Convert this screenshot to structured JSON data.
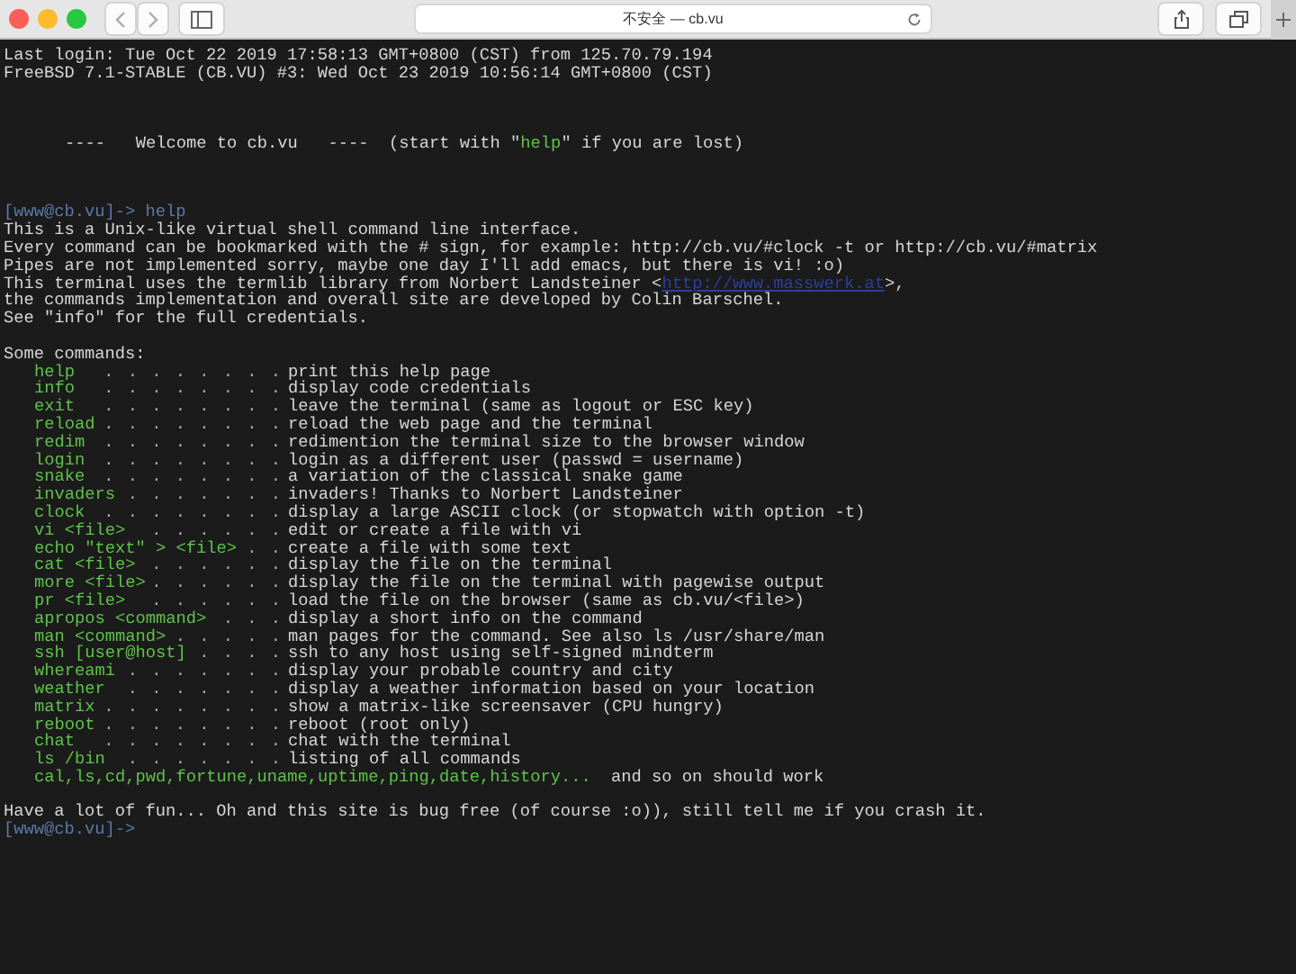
{
  "browser": {
    "address": "不安全 — cb.vu"
  },
  "login_lines": [
    "Last login: Tue Oct 22 2019 17:58:13 GMT+0800 (CST) from 125.70.79.194",
    "FreeBSD 7.1-STABLE (CB.VU) #3: Wed Oct 23 2019 10:56:14 GMT+0800 (CST)"
  ],
  "welcome": [
    {
      "kind": "plain",
      "text": "----   Welcome to cb.vu   ----  (start with \""
    },
    {
      "kind": "command",
      "text": "help"
    },
    {
      "kind": "plain",
      "text": "\" if you are lost)"
    }
  ],
  "help_prompt": {
    "prompt": "[www@cb.vu]->",
    "command": "help"
  },
  "help_lines": [
    [
      {
        "kind": "plain",
        "text": "This is a Unix-like virtual shell command line interface."
      }
    ],
    [
      {
        "kind": "plain",
        "text": "Every command can be bookmarked with the # sign, for example: http://cb.vu/#clock -t or http://cb.vu/#matrix"
      }
    ],
    [
      {
        "kind": "plain",
        "text": "Pipes are not implemented sorry, maybe one day I'll add emacs, but there is vi! :o)"
      }
    ],
    [
      {
        "kind": "plain",
        "text": "This terminal uses the termlib library from Norbert Landsteiner <"
      },
      {
        "kind": "link",
        "text": "http://www.masswerk.at"
      },
      {
        "kind": "plain",
        "text": ">,"
      }
    ],
    [
      {
        "kind": "plain",
        "text": "the commands implementation and overall site are developed by Colin Barschel."
      }
    ],
    [
      {
        "kind": "plain",
        "text": "See \"info\" for the full credentials."
      }
    ]
  ],
  "commands_heading": "Some commands:",
  "commands": [
    {
      "command": "help",
      "dots": ". . . . . . . .",
      "description": "print this help page"
    },
    {
      "command": "info",
      "dots": ". . . . . . . .",
      "description": "display code credentials"
    },
    {
      "command": "exit",
      "dots": ". . . . . . . .",
      "description": "leave the terminal (same as logout or ESC key)"
    },
    {
      "command": "reload",
      "dots": ". . . . . . . .",
      "description": "reload the web page and the terminal"
    },
    {
      "command": "redim",
      "dots": ". . . . . . . .",
      "description": "redimention the terminal size to the browser window"
    },
    {
      "command": "login",
      "dots": ". . . . . . . .",
      "description": "login as a different user (passwd = username)"
    },
    {
      "command": "snake",
      "dots": ". . . . . . . .",
      "description": "a variation of the classical snake game"
    },
    {
      "command": "invaders",
      "dots": ". . . . . . .",
      "description": "invaders! Thanks to Norbert Landsteiner"
    },
    {
      "command": "clock",
      "dots": ". . . . . . . .",
      "description": "display a large ASCII clock (or stopwatch with option -t)"
    },
    {
      "command": "vi <file>",
      "dots": ". . . . . .",
      "description": "edit or create a file with vi"
    },
    {
      "command": "echo \"text\" > <file>",
      "dots": ". .",
      "description": "create a file with some text"
    },
    {
      "command": "cat <file>",
      "dots": ". . . . . .",
      "description": "display the file on the terminal"
    },
    {
      "command": "more <file>",
      "dots": ". . . . . .",
      "description": "display the file on the terminal with pagewise output"
    },
    {
      "command": "pr <file>",
      "dots": ". . . . . .",
      "description": "load the file on the browser (same as cb.vu/<file>)"
    },
    {
      "command": "apropos <command>",
      "dots": ". . .",
      "description": "display a short info on the command"
    },
    {
      "command": "man <command>",
      "dots": ". . . . .",
      "description": "man pages for the command. See also ls /usr/share/man"
    },
    {
      "command": "ssh [user@host]",
      "dots": ". . . .",
      "description": "ssh to any host using self-signed mindterm"
    },
    {
      "command": "whereami",
      "dots": ". . . . . . .",
      "description": "display your probable country and city"
    },
    {
      "command": "weather",
      "dots": ". . . . . . .",
      "description": "display a weather information based on your location"
    },
    {
      "command": "matrix",
      "dots": ". . . . . . . .",
      "description": "show a matrix-like screensaver (CPU hungry)"
    },
    {
      "command": "reboot",
      "dots": ". . . . . . . .",
      "description": "reboot (root only)"
    },
    {
      "command": "chat",
      "dots": ". . . . . . . .",
      "description": "chat with the terminal"
    },
    {
      "command": "ls /bin",
      "dots": ". . . . . . .",
      "description": "listing of all commands"
    }
  ],
  "misc_commands": {
    "commands": "cal,ls,cd,pwd,fortune,uname,uptime,ping,date,history...",
    "note": "and so on should work"
  },
  "footer": "Have a lot of fun... Oh and this site is bug free (of course :o)), still tell me if you crash it.",
  "final_prompt": "[www@cb.vu]->"
}
